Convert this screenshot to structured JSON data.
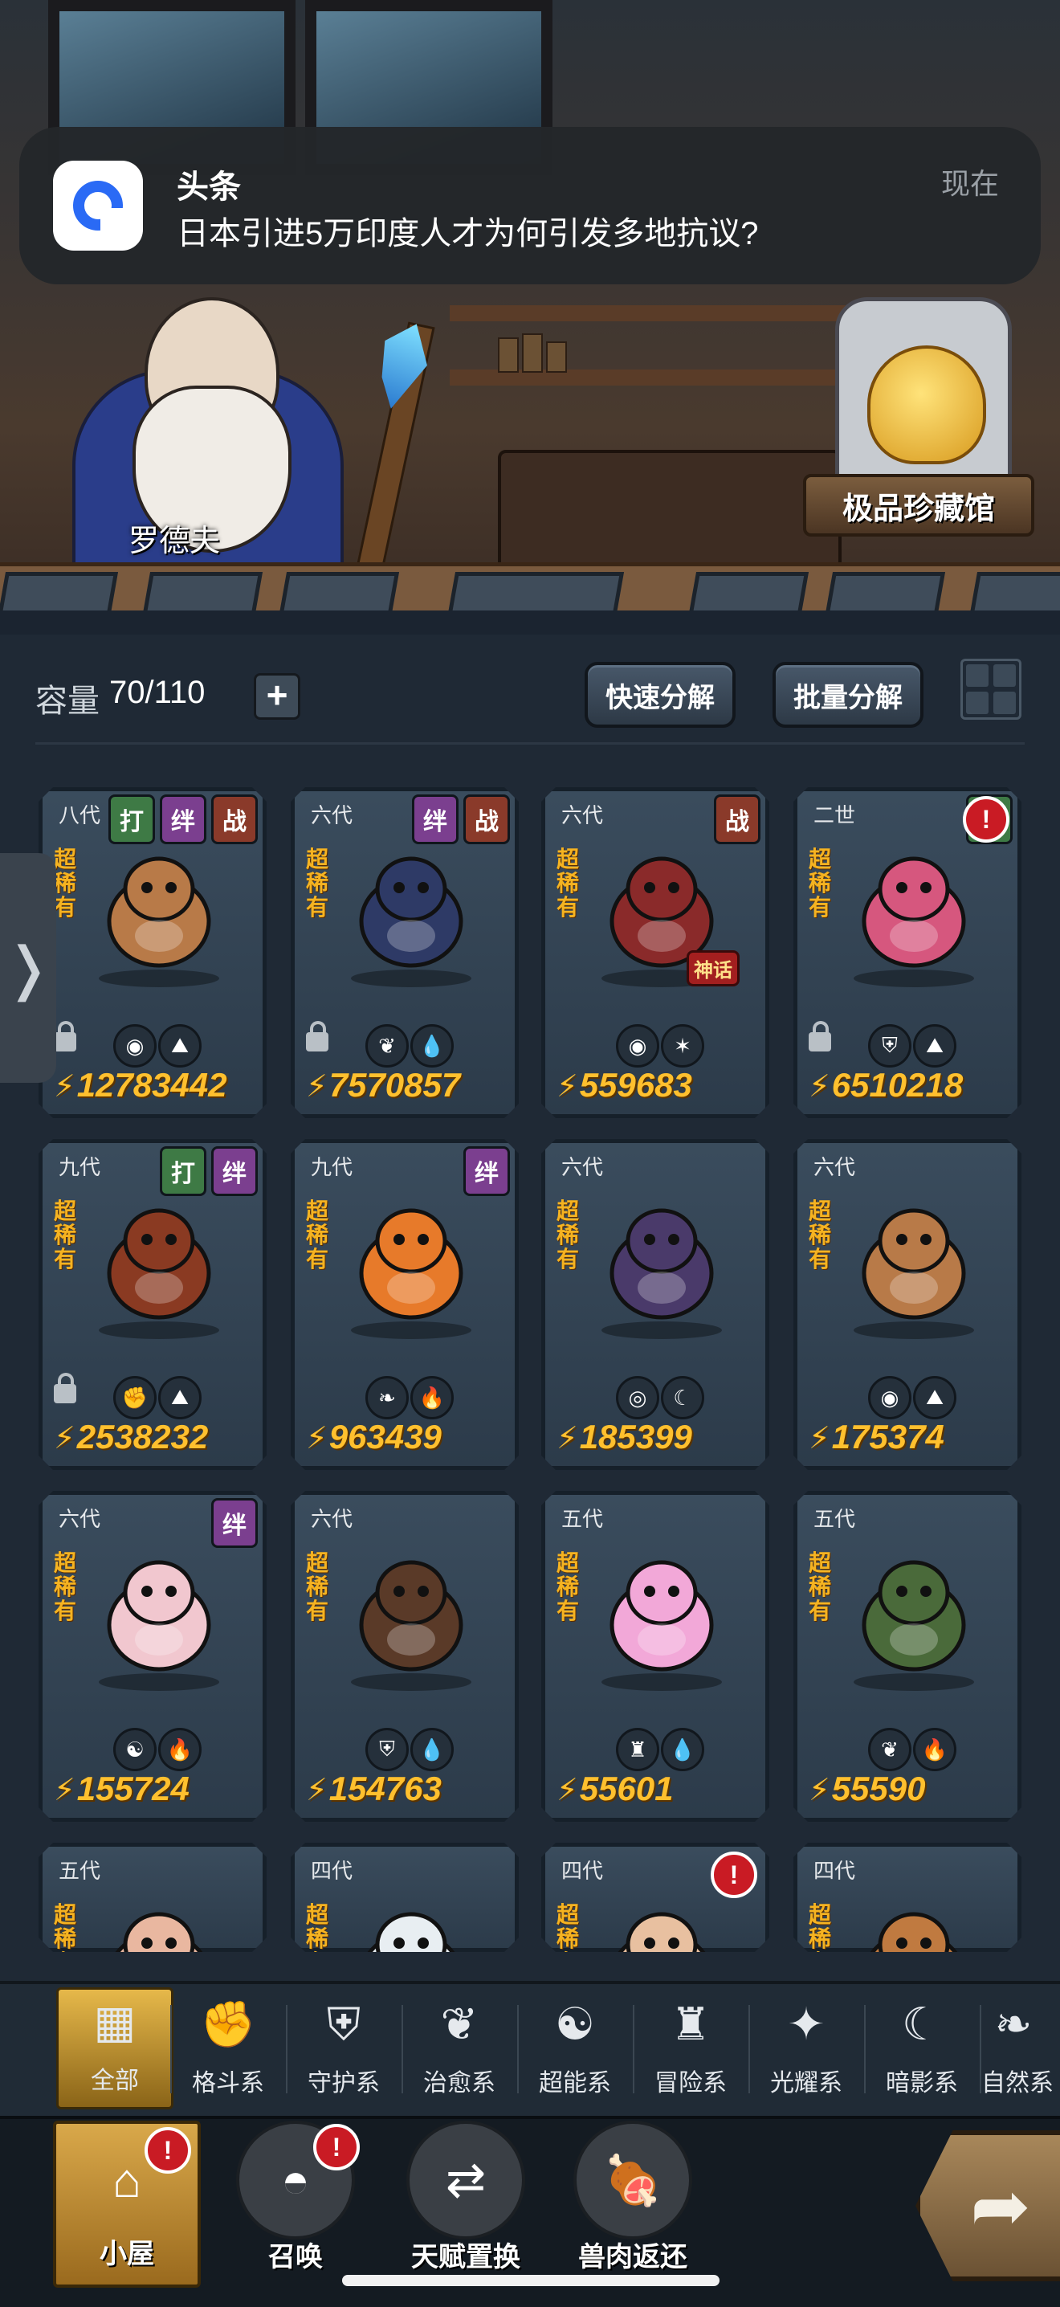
{
  "notification": {
    "app": "头条",
    "message": "日本引进5万印度人才为何引发多地抗议?",
    "time": "现在"
  },
  "scene": {
    "npc_name": "罗德夫",
    "museum_label": "极品珍藏馆"
  },
  "inventory": {
    "capacity_label": "容量",
    "capacity_value": "70/110",
    "quick_decompose": "快速分解",
    "batch_decompose": "批量分解"
  },
  "cards": [
    {
      "gen": "八代",
      "rarity": "超稀有",
      "tags": [
        "打",
        "绊",
        "战"
      ],
      "power": "12783442",
      "locked": true,
      "elements": [
        "fighter-icon",
        "earth-icon"
      ],
      "color": "#b87a48"
    },
    {
      "gen": "六代",
      "rarity": "超稀有",
      "tags": [
        "绊",
        "战"
      ],
      "power": "7570857",
      "locked": true,
      "elements": [
        "leaf-icon",
        "water-icon"
      ],
      "color": "#2e3a66"
    },
    {
      "gen": "六代",
      "rarity": "超稀有",
      "tags": [
        "战"
      ],
      "power": "559683",
      "locked": false,
      "elements": [
        "fighter-icon",
        "light-icon"
      ],
      "color": "#8a2a2a",
      "badge": "神话"
    },
    {
      "gen": "二世",
      "rarity": "超稀有",
      "tags": [
        "打"
      ],
      "alert": true,
      "power": "6510218",
      "locked": true,
      "elements": [
        "shield-icon",
        "earth-icon"
      ],
      "color": "#d6577e"
    },
    {
      "gen": "九代",
      "rarity": "超稀有",
      "tags": [
        "打",
        "绊"
      ],
      "power": "2538232",
      "locked": true,
      "elements": [
        "fist-icon",
        "earth-icon"
      ],
      "color": "#8a3a22"
    },
    {
      "gen": "九代",
      "rarity": "超稀有",
      "tags": [
        "绊"
      ],
      "power": "963439",
      "locked": false,
      "elements": [
        "sprout-icon",
        "fire-icon"
      ],
      "color": "#e77a2a"
    },
    {
      "gen": "六代",
      "rarity": "超稀有",
      "tags": [],
      "power": "185399",
      "locked": false,
      "elements": [
        "eye-icon",
        "shadow-icon"
      ],
      "color": "#4a3a6a"
    },
    {
      "gen": "六代",
      "rarity": "超稀有",
      "tags": [],
      "power": "175374",
      "locked": false,
      "elements": [
        "fighter-icon",
        "earth-icon"
      ],
      "color": "#b87a48"
    },
    {
      "gen": "六代",
      "rarity": "超稀有",
      "tags": [
        "绊"
      ],
      "power": "155724",
      "locked": false,
      "elements": [
        "alien-icon",
        "fire-icon"
      ],
      "color": "#f1c7cf"
    },
    {
      "gen": "六代",
      "rarity": "超稀有",
      "tags": [],
      "power": "154763",
      "locked": false,
      "elements": [
        "shield-icon",
        "water-icon"
      ],
      "color": "#5a3a28"
    },
    {
      "gen": "五代",
      "rarity": "超稀有",
      "tags": [],
      "power": "55601",
      "locked": false,
      "elements": [
        "adventure-icon",
        "water-icon"
      ],
      "color": "#f2a8d8"
    },
    {
      "gen": "五代",
      "rarity": "超稀有",
      "tags": [],
      "power": "55590",
      "locked": false,
      "elements": [
        "leaf-icon",
        "fire-icon"
      ],
      "color": "#4a6a3a"
    },
    {
      "gen": "五代",
      "rarity": "超稀有",
      "tags": [],
      "power": "",
      "locked": false,
      "elements": [],
      "color": "#e9b7a0"
    },
    {
      "gen": "四代",
      "rarity": "超稀有",
      "tags": [],
      "power": "",
      "locked": false,
      "elements": [],
      "color": "#e8eef2"
    },
    {
      "gen": "四代",
      "rarity": "超稀有",
      "tags": [],
      "alert": true,
      "power": "",
      "locked": false,
      "elements": [],
      "color": "#e8c0a0"
    },
    {
      "gen": "四代",
      "rarity": "超稀有",
      "tags": [],
      "power": "",
      "locked": false,
      "elements": [],
      "color": "#c07a40"
    }
  ],
  "filters": [
    {
      "label": "全部",
      "icon": "all-icon",
      "glyph": "▦"
    },
    {
      "label": "格斗系",
      "icon": "fist-icon",
      "glyph": "✊"
    },
    {
      "label": "守护系",
      "icon": "shield-icon",
      "glyph": "⛨"
    },
    {
      "label": "治愈系",
      "icon": "sprout-icon",
      "glyph": "❦"
    },
    {
      "label": "超能系",
      "icon": "alien-icon",
      "glyph": "☯"
    },
    {
      "label": "冒险系",
      "icon": "adventure-icon",
      "glyph": "♜"
    },
    {
      "label": "光耀系",
      "icon": "star-icon",
      "glyph": "✦"
    },
    {
      "label": "暗影系",
      "icon": "moon-icon",
      "glyph": "☾"
    },
    {
      "label": "自然系",
      "icon": "nature-icon",
      "glyph": "❧"
    }
  ],
  "nav": [
    {
      "label": "小屋",
      "icon": "house-icon",
      "glyph": "⌂",
      "alert": true
    },
    {
      "label": "召唤",
      "icon": "egg-icon",
      "glyph": "◓",
      "alert": true
    },
    {
      "label": "天赋置换",
      "icon": "swap-icon",
      "glyph": "⇄",
      "alert": false
    },
    {
      "label": "兽肉返还",
      "icon": "meat-icon",
      "glyph": "🍖",
      "alert": false
    }
  ]
}
